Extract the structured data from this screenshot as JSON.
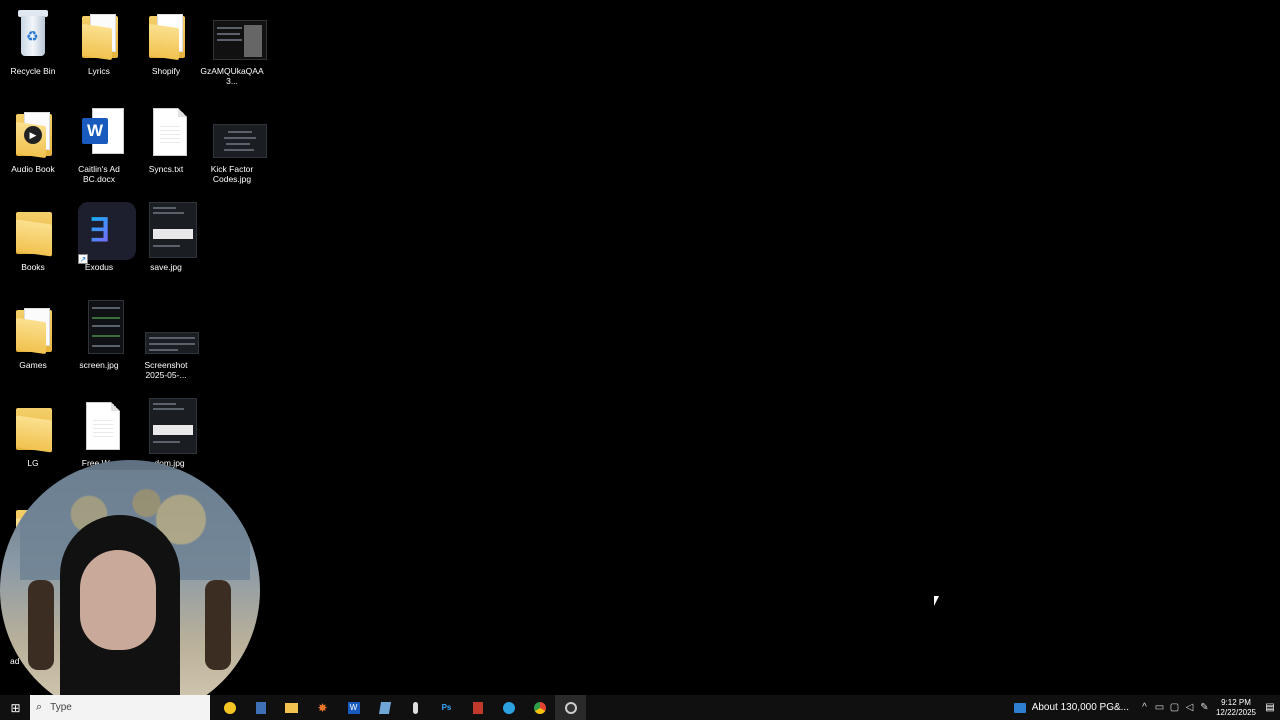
{
  "desktop": {
    "icons": {
      "recycle_bin": "Recycle Bin",
      "lyrics": "Lyrics",
      "shopify": "Shopify",
      "gzam": "GzAMQUkaQAA3...",
      "audio_book": "Audio Book",
      "caitlins": "Caitlin's Ad BC.docx",
      "syncs": "Syncs.txt",
      "kick_factor": "Kick Factor Codes.jpg",
      "books": "Books",
      "exodus": "Exodus",
      "save": "save.jpg",
      "games": "Games",
      "screen": "screen.jpg",
      "screenshot": "Screenshot 2025-05-...",
      "lg": "LG",
      "free": "Free W...",
      "dom": "...dom.jpg",
      "partial_ad": "ad"
    }
  },
  "taskbar": {
    "search_placeholder": "Type",
    "news": "About 130,000 PG&...",
    "time": "9:12 PM",
    "date": "12/22/2025",
    "start_icon": "windows-start-icon",
    "apps": [
      "emoji-app-icon",
      "calculator-icon",
      "file-explorer-icon",
      "app-icon",
      "word-icon",
      "notepad-icon",
      "microphone-icon",
      "photoshop-icon",
      "app-icon",
      "telegram-icon",
      "chrome-icon",
      "obs-icon"
    ]
  },
  "colors": {
    "desktop_bg": "#000000",
    "taskbar_bg": "#101010",
    "folder": "#f1c24f",
    "word_blue": "#185abd"
  }
}
